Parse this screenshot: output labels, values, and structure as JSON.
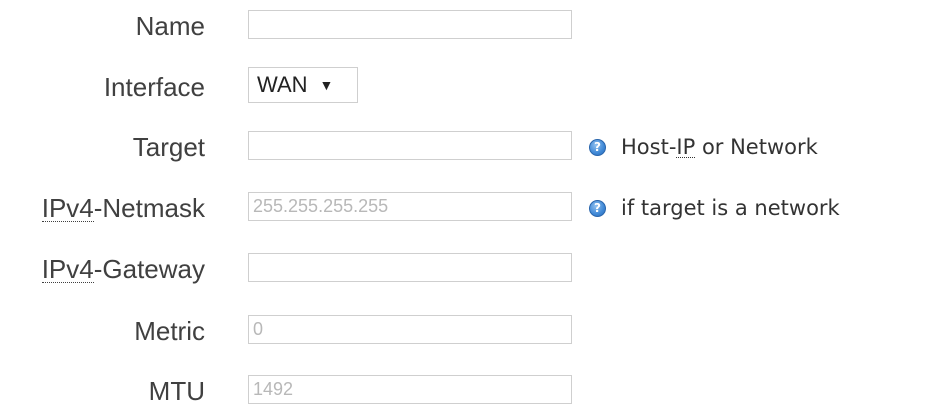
{
  "form": {
    "name": {
      "label": "Name",
      "value": "",
      "placeholder": ""
    },
    "interface": {
      "label": "Interface",
      "selected": "WAN",
      "arrow": "▼"
    },
    "target": {
      "label": "Target",
      "value": "",
      "placeholder": "",
      "hint_prefix": "Host-",
      "hint_abbr": "IP",
      "hint_suffix": " or Network",
      "help_icon": "?"
    },
    "netmask": {
      "label": "IPv4-Netmask",
      "label_abbr": "IPv4",
      "label_rest": "-Netmask",
      "value": "",
      "placeholder": "255.255.255.255",
      "hint": "if target is a network",
      "help_icon": "?"
    },
    "gateway": {
      "label_abbr": "IPv4",
      "label_rest": "-Gateway",
      "value": "",
      "placeholder": ""
    },
    "metric": {
      "label": "Metric",
      "value": "",
      "placeholder": "0"
    },
    "mtu": {
      "label": "MTU",
      "value": "",
      "placeholder": "1492"
    }
  },
  "colors": {
    "label_text": "#404040",
    "field_border": "#cfcfcf",
    "placeholder_text": "#b8b8b8",
    "help_icon_blue": "#3f88d6"
  },
  "icons": {
    "help": "help-icon"
  }
}
